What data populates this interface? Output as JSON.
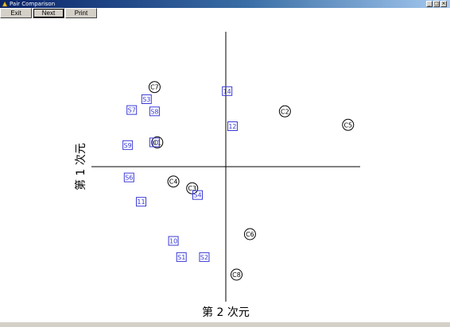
{
  "window": {
    "title": "Pair Comparison"
  },
  "toolbar": {
    "buttons": [
      "Exit",
      "Next",
      "Print"
    ]
  },
  "chart_data": {
    "type": "scatter",
    "xlabel": "第 2 次元",
    "ylabel": "第 1 次元",
    "xlim": [
      -10,
      10
    ],
    "ylim": [
      -10,
      10
    ],
    "grid": false,
    "series": [
      {
        "marker": "circle",
        "points": [
          {
            "label": "C7",
            "x": -5.3,
            "y": 5.9
          },
          {
            "label": "C2",
            "x": 4.4,
            "y": 4.1
          },
          {
            "label": "C5",
            "x": 9.1,
            "y": 3.1
          },
          {
            "label": "C1",
            "x": -5.1,
            "y": 1.8
          },
          {
            "label": "C4",
            "x": -3.9,
            "y": -1.1
          },
          {
            "label": "C3",
            "x": -2.5,
            "y": -1.6
          },
          {
            "label": "C6",
            "x": 1.8,
            "y": -5.0
          },
          {
            "label": "C8",
            "x": 0.8,
            "y": -8.0
          }
        ]
      },
      {
        "marker": "square",
        "points": [
          {
            "label": "S3",
            "x": -5.9,
            "y": 5.0
          },
          {
            "label": "S7",
            "x": -7.0,
            "y": 4.2
          },
          {
            "label": "S8",
            "x": -5.3,
            "y": 4.1
          },
          {
            "label": "S9",
            "x": -7.3,
            "y": 1.6
          },
          {
            "label": "10",
            "x": -5.3,
            "y": 1.8
          },
          {
            "label": "S6",
            "x": -7.2,
            "y": -0.8
          },
          {
            "label": "S4",
            "x": -2.1,
            "y": -2.1
          },
          {
            "label": "11",
            "x": -6.3,
            "y": -2.6
          },
          {
            "label": "10",
            "x": -3.9,
            "y": -5.5
          },
          {
            "label": "S1",
            "x": -3.3,
            "y": -6.7
          },
          {
            "label": "S2",
            "x": -1.6,
            "y": -6.7
          },
          {
            "label": "14",
            "x": 0.1,
            "y": 5.6
          },
          {
            "label": "12",
            "x": 0.5,
            "y": 3.0
          }
        ]
      }
    ]
  },
  "colors": {
    "circle": "#000000",
    "square": "#3b3bd6",
    "axis": "#000000"
  }
}
